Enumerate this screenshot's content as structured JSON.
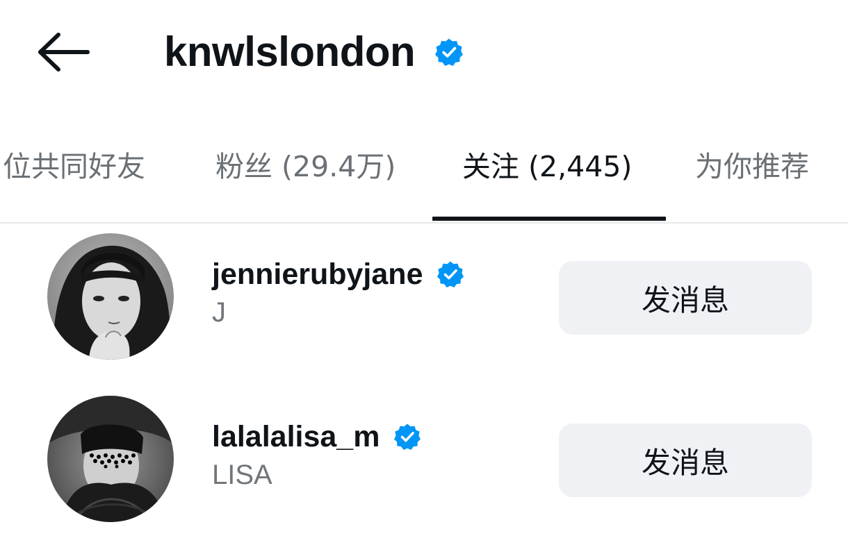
{
  "header": {
    "title": "knwlslondon",
    "back_icon": "arrow-left-icon",
    "verified_icon": "verified-badge-icon"
  },
  "tabs": [
    {
      "label": "位共同好友",
      "active": false
    },
    {
      "label": "粉丝 (29.4万)",
      "active": false
    },
    {
      "label": "关注 (2,445)",
      "active": true
    },
    {
      "label": "为你推荐",
      "active": false
    }
  ],
  "following": [
    {
      "username": "jennierubyjane",
      "name": "J",
      "verified": true,
      "button_label": "发消息"
    },
    {
      "username": "lalalalisa_m",
      "name": "LISA",
      "verified": true,
      "button_label": "发消息"
    }
  ],
  "colors": {
    "verified_blue": "#0095f6",
    "text_primary": "#0f1419",
    "text_secondary": "#71767b",
    "button_bg": "#eff1f4"
  }
}
